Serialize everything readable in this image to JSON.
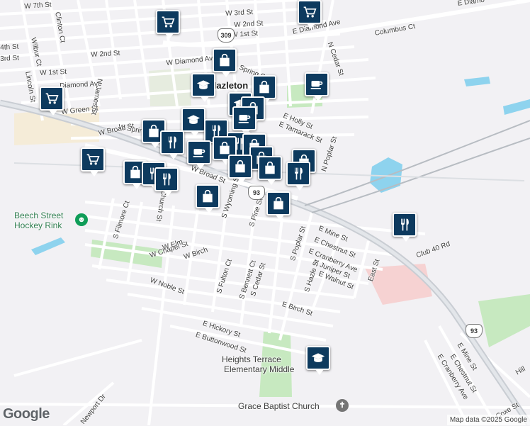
{
  "map": {
    "place_name": "Hazleton",
    "place_prefix_hidden": "Ha",
    "attribution": "Map data ©2025 Google",
    "logo": "Google",
    "colors": {
      "background": "#f2f1f4",
      "road": "#ffffff",
      "highway": "#c9cdd3",
      "park": "#c7e9c0",
      "water": "#8ed3ee",
      "hospital": "#f6d2d2",
      "marker": "#0d3a5e",
      "industrial": "#f5ecd8"
    },
    "route_shields": [
      "309",
      "93",
      "93"
    ],
    "pois": [
      {
        "label": "Beech Street Hockey Rink",
        "line1": "Beech Street",
        "line2": "Hockey Rink",
        "icon": "leisure-icon"
      },
      {
        "label": "Heights Terrace Elementary Middle",
        "line1": "Heights Terrace",
        "line2": "Elementary Middle",
        "icon": "school-icon"
      },
      {
        "label": "Grace Baptist Church",
        "icon": "church-icon"
      }
    ],
    "streets": [
      "W 7th St",
      "W 3rd St",
      "W 2nd St",
      "W 1st St",
      "E Diamond Ave",
      "E Diamo",
      "Columbus Ct",
      "Clinton Ct",
      "Wilbur Ct",
      "4th St",
      "3rd St",
      "W 2nd St",
      "W 1st St",
      "Lincoln St",
      "Diamond Ave",
      "W Diamond Ave",
      "Spring St",
      "N James St",
      "W Green St",
      "W Spring",
      "W Broad St",
      "N Cedar St",
      "E Holly St",
      "E Tamarack St",
      "N Poplar St",
      "W Broad St",
      "S Church St",
      "S Wyoming St",
      "S Pine St",
      "E Mine St",
      "E Chestnut St",
      "E Cranberry Ave",
      "E Juniper St",
      "E Walnut St",
      "Club 40 Rd",
      "East St",
      "S Filmore Ct",
      "W Chapel St",
      "W Elm",
      "W Birch",
      "W Noble St",
      "S Fulton Ct",
      "S Bennett Ct",
      "S Cedar St",
      "S Poplar St",
      "S Hazle St",
      "E Birch St",
      "E Hickory St",
      "E Buttonwood St",
      "Newport Dr",
      "E Mine St",
      "E Chestnut St",
      "E Cranberry Ave",
      "Coxe St",
      "Hill"
    ],
    "markers": [
      {
        "type": "shopping-cart-icon"
      },
      {
        "type": "shopping-cart-icon"
      },
      {
        "type": "shopping-cart-icon"
      },
      {
        "type": "shopping-cart-icon"
      },
      {
        "type": "shopping-bag-icon"
      },
      {
        "type": "school-icon"
      },
      {
        "type": "shopping-bag-icon"
      },
      {
        "type": "cafe-icon"
      },
      {
        "type": "school-icon"
      },
      {
        "type": "shopping-bag-icon"
      },
      {
        "type": "cafe-icon"
      },
      {
        "type": "school-icon"
      },
      {
        "type": "shopping-bag-icon"
      },
      {
        "type": "restaurant-icon"
      },
      {
        "type": "restaurant-icon"
      },
      {
        "type": "restaurant-icon"
      },
      {
        "type": "cafe-icon"
      },
      {
        "type": "shopping-bag-icon"
      },
      {
        "type": "shopping-bag-icon"
      },
      {
        "type": "shopping-bag-icon"
      },
      {
        "type": "shopping-bag-icon"
      },
      {
        "type": "restaurant-icon"
      },
      {
        "type": "shopping-bag-icon"
      },
      {
        "type": "shopping-bag-icon"
      },
      {
        "type": "restaurant-icon"
      },
      {
        "type": "shopping-bag-icon"
      },
      {
        "type": "shopping-bag-icon"
      },
      {
        "type": "restaurant-icon"
      },
      {
        "type": "shopping-bag-icon"
      },
      {
        "type": "restaurant-icon"
      },
      {
        "type": "school-icon"
      }
    ]
  }
}
